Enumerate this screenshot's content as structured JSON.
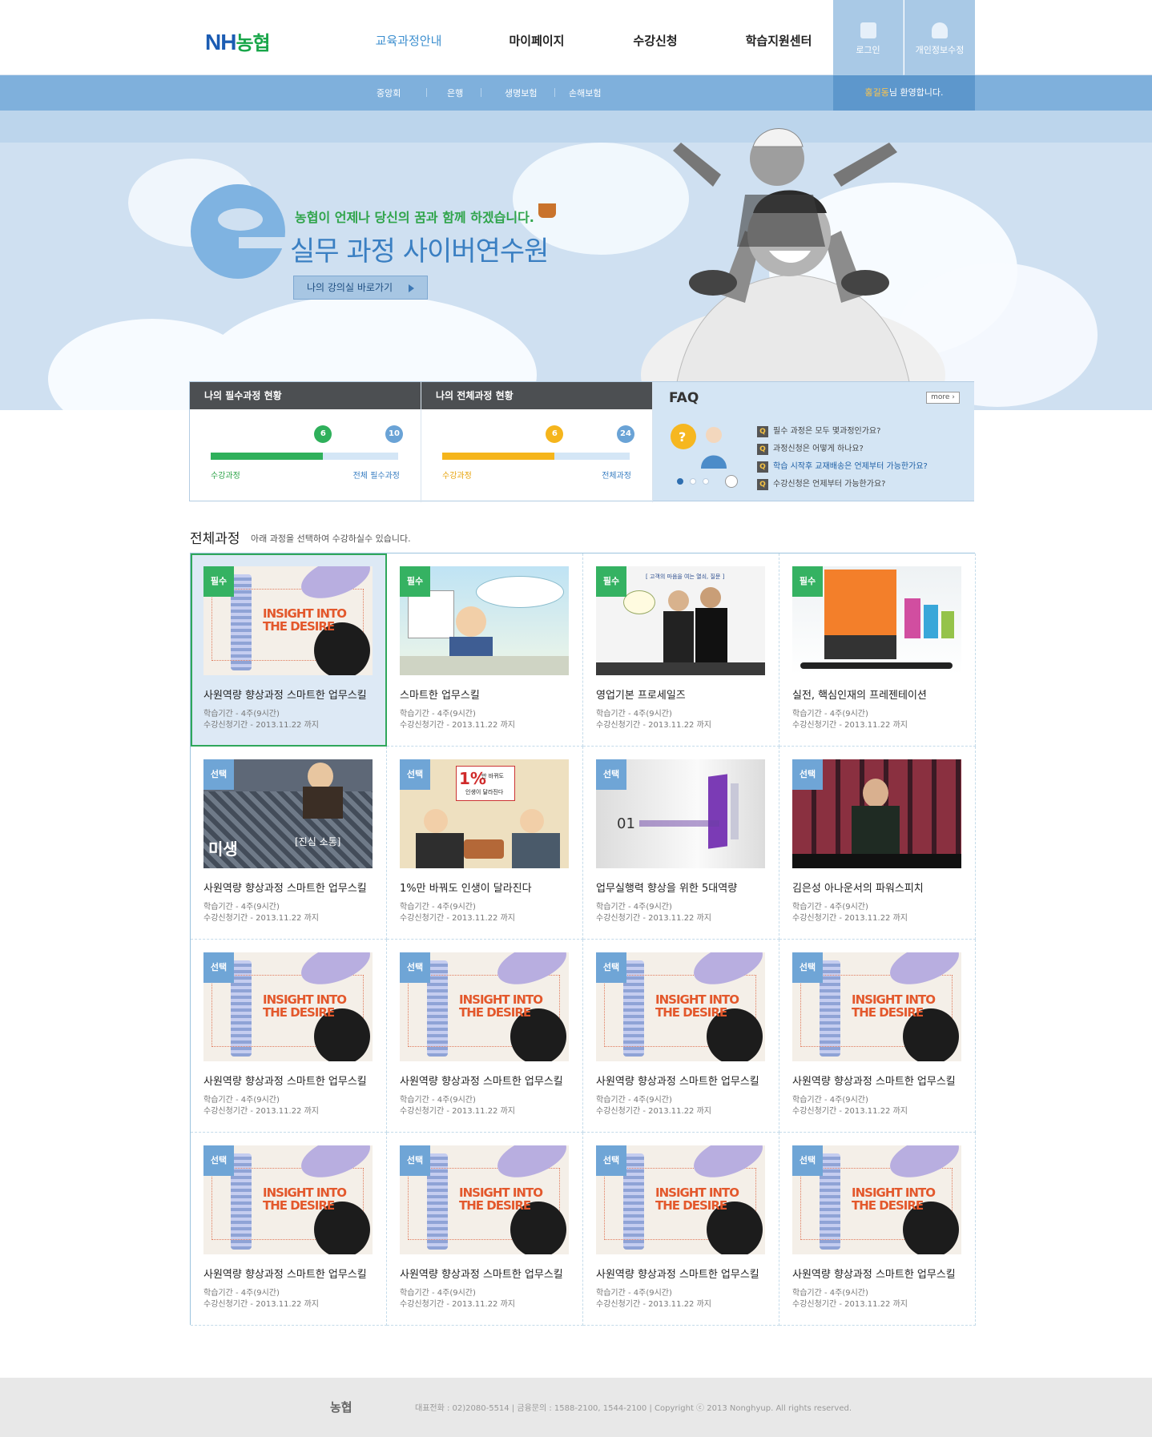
{
  "header": {
    "logo": {
      "nh": "NH",
      "name": "농협"
    },
    "nav": [
      {
        "label": "교육과정안내",
        "active": true
      },
      {
        "label": "마이페이지",
        "active": false
      },
      {
        "label": "수강신청",
        "active": false
      },
      {
        "label": "학습지원센터",
        "active": false
      }
    ],
    "utility": [
      {
        "label": "로그인",
        "icon": "lock-icon"
      },
      {
        "label": "개인정보수정",
        "icon": "user-icon"
      }
    ],
    "accent": "#7fb0dc"
  },
  "subnav": {
    "items": [
      "중앙회",
      "은행",
      "생명보험",
      "손해보험"
    ],
    "welcome_name": "홍길동",
    "welcome_suffix": "님 환영합니다."
  },
  "hero": {
    "slogan": "농협이 언제나 당신의 꿈과 함께 하겠습니다.",
    "title": "실무 과정 사이버연수원",
    "button": "나의 강의실 바로가기"
  },
  "status": {
    "required": {
      "title": "나의 필수과정 현황",
      "done": 6,
      "total": 10,
      "done_label": "수강과정",
      "total_label": "전체 필수과정",
      "color": "#2fb05b"
    },
    "all": {
      "title": "나의 전체과정 현황",
      "done": 6,
      "total": 24,
      "done_label": "수강과정",
      "total_label": "전체과정",
      "color": "#f5b51c"
    }
  },
  "faq": {
    "title": "FAQ",
    "more": "more",
    "questions": [
      "필수 과정은 모두 몇과정인가요?",
      "과정신청은 어떻게 하나요?",
      "학습 시작후 교재배송은 언제부터 가능한가요?",
      "수강신청은 언제부터 가능한가요?"
    ],
    "active_index": 2
  },
  "courses": {
    "title": "전체과정",
    "subtitle": "아래 과정을 선택하여 수강하실수 있습니다.",
    "period_label": "학습기간 - 4주(9시간)",
    "apply_label": "수강신청기간 - 2013.11.22 까지",
    "items": [
      {
        "badge": "필수",
        "name": "사원역량 향상과정 스마트한 업무스킬",
        "thumb": "insight",
        "selected": true
      },
      {
        "badge": "필수",
        "name": "스마트한 업무스킬",
        "thumb": "cartoon"
      },
      {
        "badge": "필수",
        "name": "영업기본 프로세일즈",
        "thumb": "sales"
      },
      {
        "badge": "필수",
        "name": "실전, 핵심인재의 프레젠테이션",
        "thumb": "books"
      },
      {
        "badge": "선택",
        "name": "사원역량 향상과정 스마트한 업무스킬",
        "thumb": "misaeng"
      },
      {
        "badge": "선택",
        "name": "1%만 바꿔도 인생이 달라진다",
        "thumb": "onepct"
      },
      {
        "badge": "선택",
        "name": "업무실행력 향상을 위한 5대역량",
        "thumb": "five"
      },
      {
        "badge": "선택",
        "name": "김은성 아나운서의 파워스피치",
        "thumb": "speech"
      },
      {
        "badge": "선택",
        "name": "사원역량 향상과정 스마트한 업무스킬",
        "thumb": "insight"
      },
      {
        "badge": "선택",
        "name": "사원역량 향상과정 스마트한 업무스킬",
        "thumb": "insight"
      },
      {
        "badge": "선택",
        "name": "사원역량 향상과정 스마트한 업무스킬",
        "thumb": "insight"
      },
      {
        "badge": "선택",
        "name": "사원역량 향상과정 스마트한 업무스킬",
        "thumb": "insight"
      },
      {
        "badge": "선택",
        "name": "사원역량 향상과정 스마트한 업무스킬",
        "thumb": "insight"
      },
      {
        "badge": "선택",
        "name": "사원역량 향상과정 스마트한 업무스킬",
        "thumb": "insight"
      },
      {
        "badge": "선택",
        "name": "사원역량 향상과정 스마트한 업무스킬",
        "thumb": "insight"
      },
      {
        "badge": "선택",
        "name": "사원역량 향상과정 스마트한 업무스킬",
        "thumb": "insight"
      }
    ],
    "thumb_text": {
      "insight_1": "INSIGHT INTO",
      "insight_2": "THE DESIRE",
      "onepct_1": "1%",
      "onepct_2": "만 바뀌도",
      "onepct_3": "인생이 달라진다",
      "five_num": "01",
      "misaeng": "미생",
      "misaeng_sub": "[진심 소통]",
      "sales_top": "[ 고객의 마음을 여는 열쇠, 질문 ]"
    }
  },
  "footer": {
    "logo": "농협",
    "text": "대표전화 : 02)2080-5514 | 금융문의 : 1588-2100, 1544-2100 | Copyright ⓒ 2013 Nonghyup. All rights reserved."
  }
}
